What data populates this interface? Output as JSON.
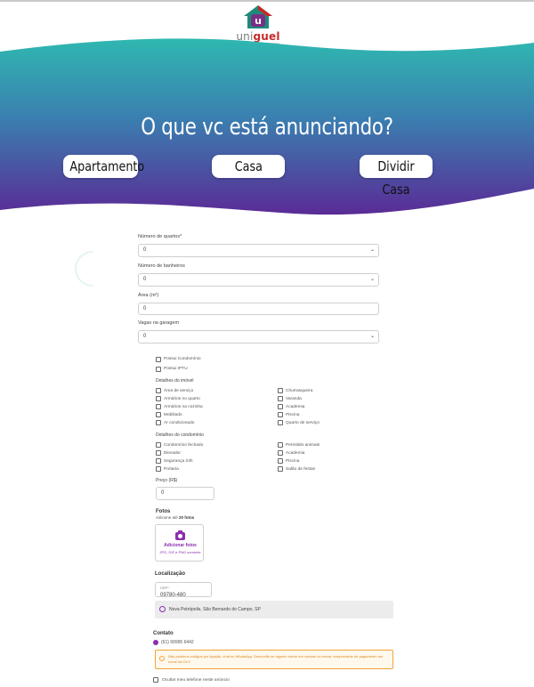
{
  "logo": {
    "uni": "uni",
    "guel": "guel"
  },
  "hero": {
    "title": "O que vc está anunciando?",
    "options": [
      "Apartamento",
      "Casa",
      "Dividir Casa"
    ]
  },
  "form": {
    "bedrooms": {
      "label": "Número de quartos*",
      "value": "0"
    },
    "bathrooms": {
      "label": "Número de banheiros",
      "value": "0"
    },
    "area": {
      "label": "Área (m²)",
      "value": "0"
    },
    "garage": {
      "label": "Vagas na garagem",
      "value": "0"
    },
    "flags": [
      "Possui Condomínio",
      "Possui IPTU"
    ],
    "property_details": {
      "title": "Detalhes do imóvel",
      "left": [
        "Área de serviço",
        "Armários no quarto",
        "Armários na cozinha",
        "Mobiliado",
        "Ar condicionado"
      ],
      "right": [
        "Churrasqueira",
        "Varanda",
        "Academia",
        "Piscina",
        "Quarto de serviço"
      ]
    },
    "condo_details": {
      "title": "Detalhes do condomínio",
      "left": [
        "Condomínio fechado",
        "Elevador",
        "Segurança 24h",
        "Portaria"
      ],
      "right": [
        "Permitido animais",
        "Academia",
        "Piscina",
        "Salão de festas"
      ]
    },
    "price": {
      "label": "Preço (R$)",
      "value": "0"
    },
    "photos": {
      "title": "Fotos",
      "hint_prefix": "Adicione até",
      "hint_count": "20 fotos",
      "button": "Adicionar fotos",
      "formats": "JPG, GIF e PNG somente"
    },
    "location": {
      "title": "Localização",
      "cep_label": "CEP*",
      "cep_value": "09780-480",
      "address": "Nova Petrópolis, São Bernardo do Campo, SP"
    },
    "contact": {
      "title": "Contato",
      "phone": "(61) 99995 6442",
      "warning": "Não pedimos códigos por ligação, chat ou WhatsApp. Desconfie se alguém entrar em contato ou enviar comprovante de pagamento em nome da OLX",
      "hide_phone": "Ocultar meu telefone neste anúncio"
    }
  },
  "colors": {
    "hero_top": "#2fb8b0",
    "hero_bottom": "#5a2b96",
    "accent": "#8a2fb0",
    "warn": "#f2a33a"
  }
}
